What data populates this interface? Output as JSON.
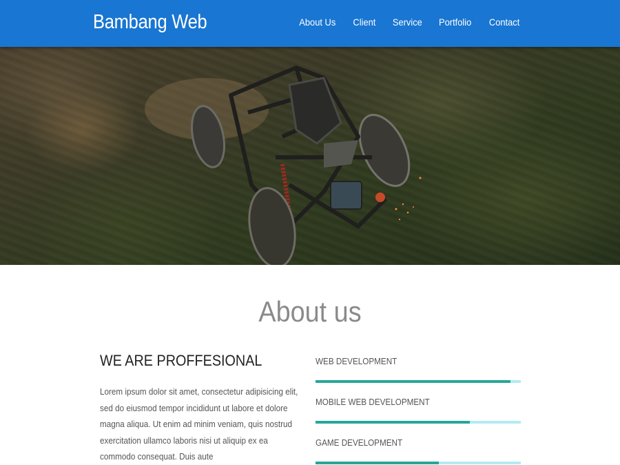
{
  "navbar": {
    "brand": "Bambang Web",
    "links": [
      {
        "label": "About Us"
      },
      {
        "label": "Client"
      },
      {
        "label": "Service"
      },
      {
        "label": "Portfolio"
      },
      {
        "label": "Contact"
      }
    ],
    "background_color": "#1976d2"
  },
  "hero": {
    "image_subject": "off-road buggy speeding through grass"
  },
  "about": {
    "title": "About us",
    "heading": "WE ARE PROFFESIONAL",
    "paragraph": "Lorem ipsum dolor sit amet, consectetur adipisicing elit, sed do eiusmod tempor incididunt ut labore et dolore magna aliqua. Ut enim ad minim veniam, quis nostrud exercitation ullamco laboris nisi ut aliquip ex ea commodo consequat. Duis aute",
    "skills": [
      {
        "name": "Web Development",
        "level": 0.95
      },
      {
        "name": "Mobile Web Development",
        "level": 0.75
      },
      {
        "name": "Game Development",
        "level": 0.6
      }
    ],
    "bar_fill_color": "#26a69a",
    "bar_track_color": "#b2ebf2"
  }
}
